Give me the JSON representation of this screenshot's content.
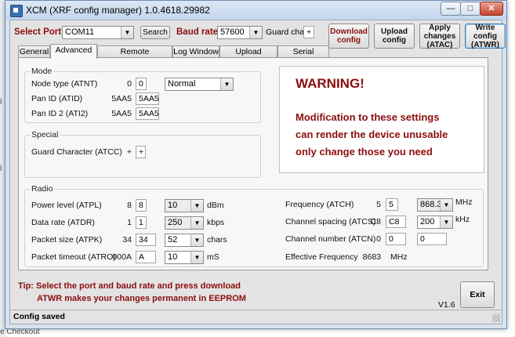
{
  "background": {
    "left_fragments": [
      "l",
      "l",
      "e Checkout"
    ]
  },
  "window": {
    "title": "XCM (XRF config manager) 1.0.4618.29982",
    "controls": {
      "minimize": "—",
      "maximize": "□",
      "close": "✕"
    }
  },
  "toolbar": {
    "select_port_label": "Select Port",
    "port_value": "COM11",
    "search_label": "Search",
    "baud_label": "Baud rate",
    "baud_value": "57600",
    "guard_label": "Guard char",
    "guard_value": "+",
    "download_label": "Download config",
    "upload_label": "Upload config",
    "apply_label": "Apply changes (ATAC)",
    "write_label": "Write config (ATWR)"
  },
  "tabs": [
    {
      "label": "General"
    },
    {
      "label": "Advanced"
    },
    {
      "label": "Remote Programming"
    },
    {
      "label": "Log Window"
    },
    {
      "label": "Upload Firmware"
    },
    {
      "label": "Serial Monitor"
    }
  ],
  "mode": {
    "title": "Mode",
    "node_type": {
      "label": "Node type (ATNT)",
      "current": "0",
      "input": "0",
      "select": "Normal"
    },
    "pan_id": {
      "label": "Pan ID (ATID)",
      "current": "5AA5",
      "input": "5AA5"
    },
    "pan_id2": {
      "label": "Pan ID 2 (ATI2)",
      "current": "5AA5",
      "input": "5AA5"
    }
  },
  "special": {
    "title": "Special",
    "guard": {
      "label": "Guard Character (ATCC)",
      "current": "+",
      "input": "+"
    }
  },
  "warning": {
    "title": "WARNING!",
    "lines": [
      "Modification to these settings",
      "can render the device unusable",
      "only change those you need"
    ]
  },
  "radio": {
    "title": "Radio",
    "power": {
      "label": "Power level (ATPL)",
      "current": "8",
      "input": "8",
      "select": "10",
      "unit": "dBm"
    },
    "data_rate": {
      "label": "Data rate (ATDR)",
      "current": "1",
      "input": "1",
      "select": "250",
      "unit": "kbps"
    },
    "packet_size": {
      "label": "Packet size (ATPK)",
      "current": "34",
      "input": "34",
      "select": "52",
      "unit": "chars"
    },
    "packet_timeout": {
      "label": "Packet timeout (ATRO)",
      "current": "000A",
      "input": "A",
      "select": "10",
      "unit": "mS"
    },
    "frequency": {
      "label": "Frequency (ATCH)",
      "current": "5",
      "input": "5",
      "select": "868.3",
      "unit": "MHz"
    },
    "channel_spacing": {
      "label": "Channel spacing (ATCS)",
      "current": "C8",
      "input": "C8",
      "select": "200",
      "unit": "kHz"
    },
    "channel_number": {
      "label": "Channel number (ATCN)",
      "current": "0",
      "input": "0",
      "input2": "0"
    },
    "effective": {
      "label": "Effective Frequency",
      "value": "8683",
      "unit": "MHz"
    }
  },
  "footer": {
    "tip_line1": "Tip: Select the port and baud rate and press download",
    "tip_line2": "ATWR makes your changes permanent in EEPROM",
    "version": "V1.6",
    "exit_label": "Exit"
  },
  "status": {
    "text": "Config saved"
  }
}
